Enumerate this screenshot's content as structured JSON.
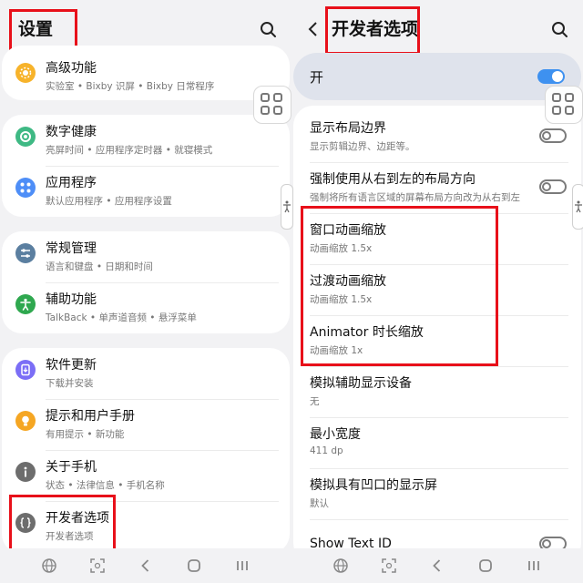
{
  "left": {
    "title": "设置",
    "items": [
      {
        "label": "高级功能",
        "sub": "实验室 • Bixby 识屏 • Bixby 日常程序",
        "icon": "advanced-features-icon",
        "color": "#f7b32b"
      },
      {
        "label": "数字健康",
        "sub": "亮屏时间 • 应用程序定时器 • 就寝模式",
        "icon": "digital-wellbeing-icon",
        "color": "#3fb984"
      },
      {
        "label": "应用程序",
        "sub": "默认应用程序 • 应用程序设置",
        "icon": "apps-icon",
        "color": "#4e8ef7"
      },
      {
        "label": "常规管理",
        "sub": "语言和键盘 • 日期和时间",
        "icon": "general-management-icon",
        "color": "#5b7fa0"
      },
      {
        "label": "辅助功能",
        "sub": "TalkBack • 单声道音频 • 悬浮菜单",
        "icon": "accessibility-icon",
        "color": "#2fa84f"
      },
      {
        "label": "软件更新",
        "sub": "下载并安装",
        "icon": "software-update-icon",
        "color": "#7b6ef6"
      },
      {
        "label": "提示和用户手册",
        "sub": "有用提示 • 新功能",
        "icon": "tips-lightbulb-icon",
        "color": "#f5a623"
      },
      {
        "label": "关于手机",
        "sub": "状态 • 法律信息 • 手机名称",
        "icon": "about-phone-info-icon",
        "color": "#6d6d6d"
      },
      {
        "label": "开发者选项",
        "sub": "开发者选项",
        "icon": "developer-options-icon",
        "color": "#6d6d6d"
      }
    ]
  },
  "right": {
    "title": "开发者选项",
    "master": {
      "label": "开",
      "state": "on"
    },
    "items": [
      {
        "label": "显示布局边界",
        "sub": "显示剪辑边界、边距等。",
        "toggle": "off"
      },
      {
        "label": "强制使用从右到左的布局方向",
        "sub": "强制将所有语言区域的屏幕布局方向改为从右到左",
        "toggle": "off"
      },
      {
        "label": "窗口动画缩放",
        "sub": "动画缩放 1.5x"
      },
      {
        "label": "过渡动画缩放",
        "sub": "动画缩放 1.5x"
      },
      {
        "label": "Animator 时长缩放",
        "sub": "动画缩放 1x"
      },
      {
        "label": "模拟辅助显示设备",
        "sub": "无"
      },
      {
        "label": "最小宽度",
        "sub": "411 dp"
      },
      {
        "label": "模拟具有凹口的显示屏",
        "sub": "默认"
      },
      {
        "label": "Show Text ID",
        "toggle": "off"
      }
    ]
  },
  "colors": {
    "accent": "#3e91f0",
    "highlight_box": "#e8101a",
    "master_bar": "#dfe3ec"
  }
}
